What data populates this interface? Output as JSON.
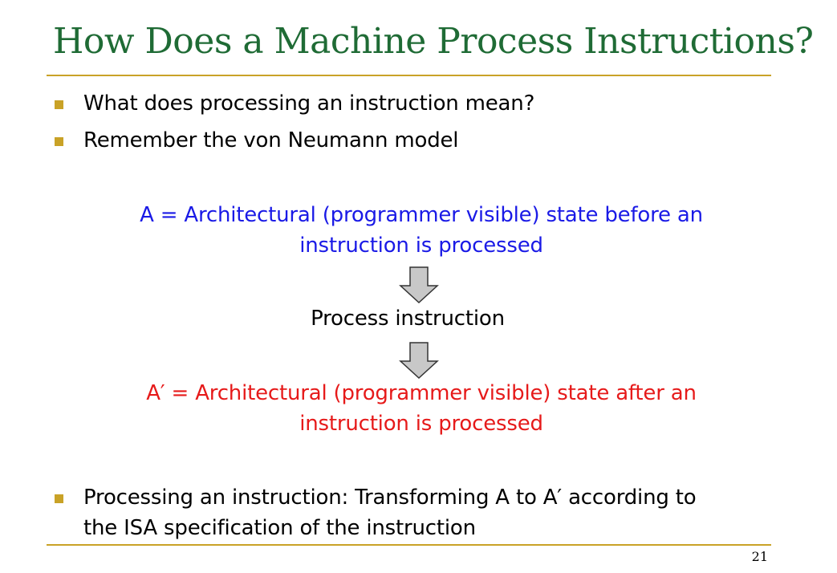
{
  "slide": {
    "title": "How Does a Machine Process Instructions?",
    "page_number": "21",
    "accent_color": "#c9a227",
    "title_color": "#1f6b35"
  },
  "bullets": [
    {
      "text": "What does processing an instruction mean?"
    },
    {
      "text": "Remember the von Neumann model"
    }
  ],
  "state_before": {
    "line1": "A = Architectural (programmer visible) state before an",
    "line2": "instruction is processed",
    "color": "#1a1ae6"
  },
  "process": {
    "label": "Process instruction",
    "arrow_color": "#c8c8c8"
  },
  "state_after": {
    "line1": "A′ = Architectural (programmer visible) state after an",
    "line2": "instruction is processed",
    "color": "#e61a1a"
  },
  "final_bullet": {
    "line1": "Processing an instruction: Transforming A to A′ according to",
    "line2": "the ISA specification of the instruction"
  }
}
